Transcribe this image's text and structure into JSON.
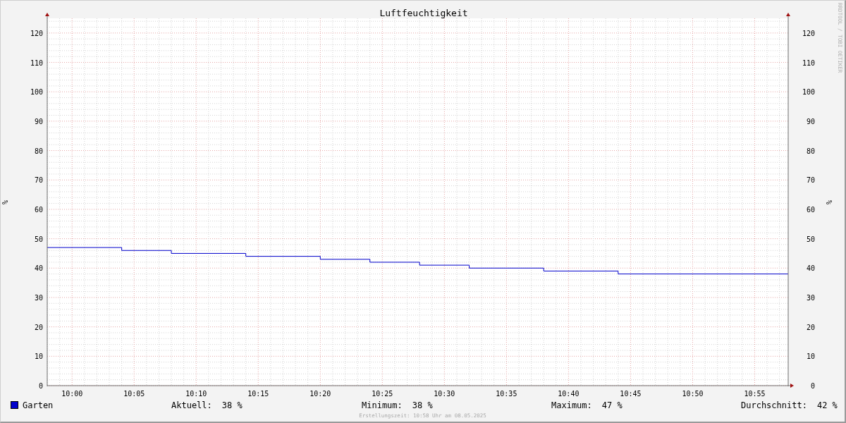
{
  "chart": {
    "vertical_credit": "RRDTOOL / TOBI OETIKER",
    "chart_data": {
      "type": "line",
      "title": "Luftfeuchtigkeit",
      "ylabel": "%",
      "x": [
        598,
        604,
        604,
        608,
        608,
        614,
        614,
        620,
        620,
        624,
        624,
        628,
        628,
        632,
        632,
        638,
        638,
        644,
        644,
        657.7
      ],
      "series": [
        {
          "name": "Garten",
          "color": "#0000cc",
          "values": [
            47,
            47,
            46,
            46,
            45,
            45,
            44,
            44,
            43,
            43,
            42,
            42,
            41,
            41,
            40,
            40,
            39,
            39,
            38,
            38
          ]
        }
      ],
      "grid": true,
      "xlim": [
        598,
        657.7
      ],
      "ylim": [
        0,
        125
      ],
      "xticks": [
        {
          "value": 600,
          "label": "10:00"
        },
        {
          "value": 605,
          "label": "10:05"
        },
        {
          "value": 610,
          "label": "10:10"
        },
        {
          "value": 615,
          "label": "10:15"
        },
        {
          "value": 620,
          "label": "10:20"
        },
        {
          "value": 625,
          "label": "10:25"
        },
        {
          "value": 630,
          "label": "10:30"
        },
        {
          "value": 635,
          "label": "10:35"
        },
        {
          "value": 640,
          "label": "10:40"
        },
        {
          "value": 645,
          "label": "10:45"
        },
        {
          "value": 650,
          "label": "10:50"
        },
        {
          "value": 655,
          "label": "10:55"
        }
      ],
      "yticks": [
        0,
        10,
        20,
        30,
        40,
        50,
        60,
        70,
        80,
        90,
        100,
        110,
        120
      ]
    },
    "right_axis": {
      "label": "%",
      "ticks": [
        "120",
        "110",
        "100",
        "90",
        "80",
        "70",
        "60",
        "50",
        "40",
        "30",
        "20",
        "10",
        "0"
      ]
    }
  },
  "legend": {
    "stats": [
      {
        "label": "Aktuell:",
        "value": "38 %"
      },
      {
        "label": "Minimum:",
        "value": "38 %"
      },
      {
        "label": "Maximum:",
        "value": "47 %"
      },
      {
        "label": "Durchschnitt:",
        "value": "42 %"
      }
    ]
  },
  "footer": "Erstellungszeit: 10:58 Uhr am 08.05.2025"
}
